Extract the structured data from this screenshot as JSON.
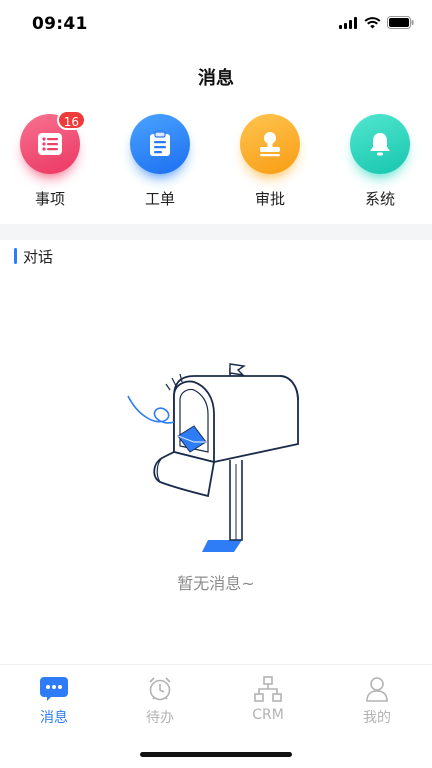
{
  "status_bar": {
    "time": "09:41",
    "icons": [
      "signal-icon",
      "wifi-icon",
      "battery-icon"
    ]
  },
  "header": {
    "title": "消息"
  },
  "entries": [
    {
      "label": "事项",
      "icon": "list-icon",
      "color": "#f0476f",
      "badge": "16"
    },
    {
      "label": "工单",
      "icon": "clipboard-icon",
      "color": "#2f86f6",
      "badge": ""
    },
    {
      "label": "审批",
      "icon": "stamp-icon",
      "color": "#fdb12f",
      "badge": ""
    },
    {
      "label": "系统",
      "icon": "bell-icon",
      "color": "#2fd8c1",
      "badge": ""
    }
  ],
  "section": {
    "title": "对话"
  },
  "empty_state": {
    "text": "暂无消息~",
    "illustration": "mailbox-illustration"
  },
  "tabbar": {
    "tabs": [
      {
        "label": "消息",
        "icon": "chat-icon",
        "active": true
      },
      {
        "label": "待办",
        "icon": "alarm-clock-icon",
        "active": false
      },
      {
        "label": "CRM",
        "icon": "org-chart-icon",
        "active": false
      },
      {
        "label": "我的",
        "icon": "user-icon",
        "active": false
      }
    ]
  },
  "colors": {
    "accent": "#2e7df6",
    "badge": "#ef3b3b",
    "muted": "#b3b3b3"
  }
}
